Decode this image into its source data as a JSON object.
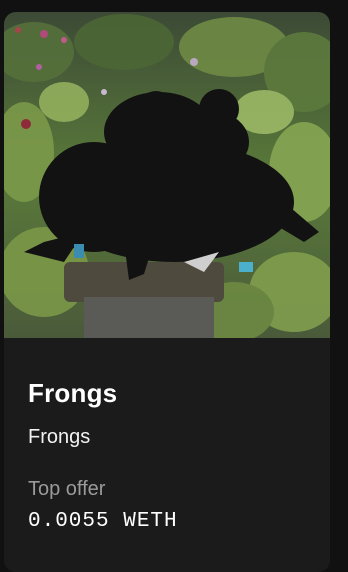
{
  "card": {
    "title": "Frongs",
    "collection": "Frongs",
    "offer_label": "Top offer",
    "offer_value": "0.0055 WETH",
    "image_icon": "frog-silhouette-nft-image"
  },
  "colors": {
    "page_bg": "#111111",
    "card_bg": "#1b1b1b",
    "title": "#ffffff",
    "muted": "#9a9a9a"
  }
}
